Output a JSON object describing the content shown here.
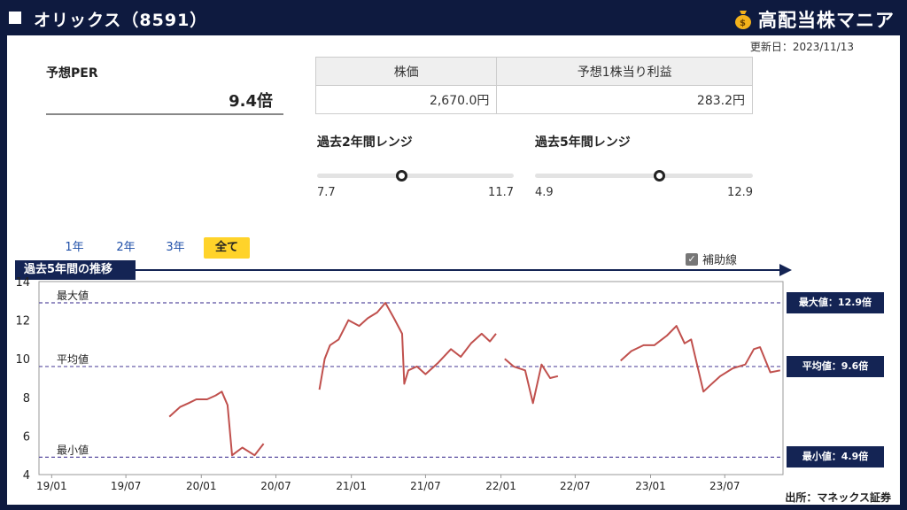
{
  "header": {
    "title": "オリックス（8591）",
    "brand": "高配当株マニア"
  },
  "updated": "更新日：2023/11/13",
  "per": {
    "label": "予想PER",
    "value": "9.4倍"
  },
  "table": {
    "headers": [
      "株価",
      "予想1株当り利益"
    ],
    "values": [
      "2,670.0円",
      "283.2円"
    ]
  },
  "range2y": {
    "title": "過去2年間レンジ",
    "min": "7.7",
    "max": "11.7",
    "position": 0.43
  },
  "range5y": {
    "title": "過去5年間レンジ",
    "min": "4.9",
    "max": "12.9",
    "position": 0.57
  },
  "tabs": [
    "1年",
    "2年",
    "3年",
    "全て"
  ],
  "active_tab": "全て",
  "aux_label": "補助線",
  "section_title": "過去5年間の推移",
  "source": "出所：マネックス証券",
  "colors": {
    "navy": "#142454",
    "line": "#c0504d",
    "accent": "#ffd32a",
    "ref": "#5a4fa0"
  },
  "chart_data": {
    "type": "line",
    "ylim": [
      4,
      14
    ],
    "yticks": [
      4,
      6,
      8,
      10,
      12,
      14
    ],
    "xticks": [
      "19/01",
      "19/07",
      "20/01",
      "20/07",
      "21/01",
      "21/07",
      "22/01",
      "22/07",
      "23/01",
      "23/07"
    ],
    "reference_lines": [
      {
        "label": "最大値",
        "value": 12.9,
        "box": "最大値：12.9倍"
      },
      {
        "label": "平均値",
        "value": 9.6,
        "box": "平均値：9.6倍"
      },
      {
        "label": "最小値",
        "value": 4.9,
        "box": "最小値：4.9倍"
      }
    ],
    "segments": [
      {
        "x": [
          "2019-10-15",
          "2019-11-10",
          "2019-12-01",
          "2019-12-20",
          "2020-01-15",
          "2020-02-05",
          "2020-02-20",
          "2020-03-05",
          "2020-03-16",
          "2020-04-10",
          "2020-05-10",
          "2020-06-01"
        ],
        "y": [
          7.0,
          7.5,
          7.7,
          7.9,
          7.9,
          8.1,
          8.3,
          7.6,
          5.0,
          5.4,
          5.0,
          5.6
        ]
      },
      {
        "x": [
          "2020-10-15",
          "2020-10-28",
          "2020-11-10",
          "2020-12-01",
          "2020-12-25",
          "2021-01-20",
          "2021-02-10",
          "2021-03-05",
          "2021-03-25",
          "2021-04-15",
          "2021-05-05",
          "2021-05-10",
          "2021-05-20",
          "2021-06-10",
          "2021-07-01",
          "2021-08-01",
          "2021-09-01",
          "2021-09-25",
          "2021-10-20",
          "2021-11-15",
          "2021-12-05",
          "2021-12-20"
        ],
        "y": [
          8.4,
          10.0,
          10.7,
          11.0,
          12.0,
          11.7,
          12.1,
          12.4,
          12.9,
          12.1,
          11.3,
          8.7,
          9.4,
          9.6,
          9.2,
          9.8,
          10.5,
          10.1,
          10.8,
          11.3,
          10.9,
          11.3
        ]
      },
      {
        "x": [
          "2022-01-10",
          "2022-02-01",
          "2022-03-01",
          "2022-03-20",
          "2022-04-10",
          "2022-05-01",
          "2022-05-20"
        ],
        "y": [
          10.0,
          9.6,
          9.4,
          7.7,
          9.7,
          9.0,
          9.1
        ]
      },
      {
        "x": [
          "2022-10-20",
          "2022-11-15",
          "2022-12-15",
          "2023-01-10",
          "2023-02-10",
          "2023-03-05",
          "2023-03-25",
          "2023-04-10",
          "2023-05-10",
          "2023-05-25",
          "2023-06-20",
          "2023-07-20",
          "2023-08-20",
          "2023-09-10",
          "2023-09-25",
          "2023-10-20",
          "2023-11-13"
        ],
        "y": [
          9.9,
          10.4,
          10.7,
          10.7,
          11.2,
          11.7,
          10.8,
          11.0,
          8.3,
          8.6,
          9.1,
          9.5,
          9.7,
          10.5,
          10.6,
          9.3,
          9.4
        ]
      }
    ]
  }
}
